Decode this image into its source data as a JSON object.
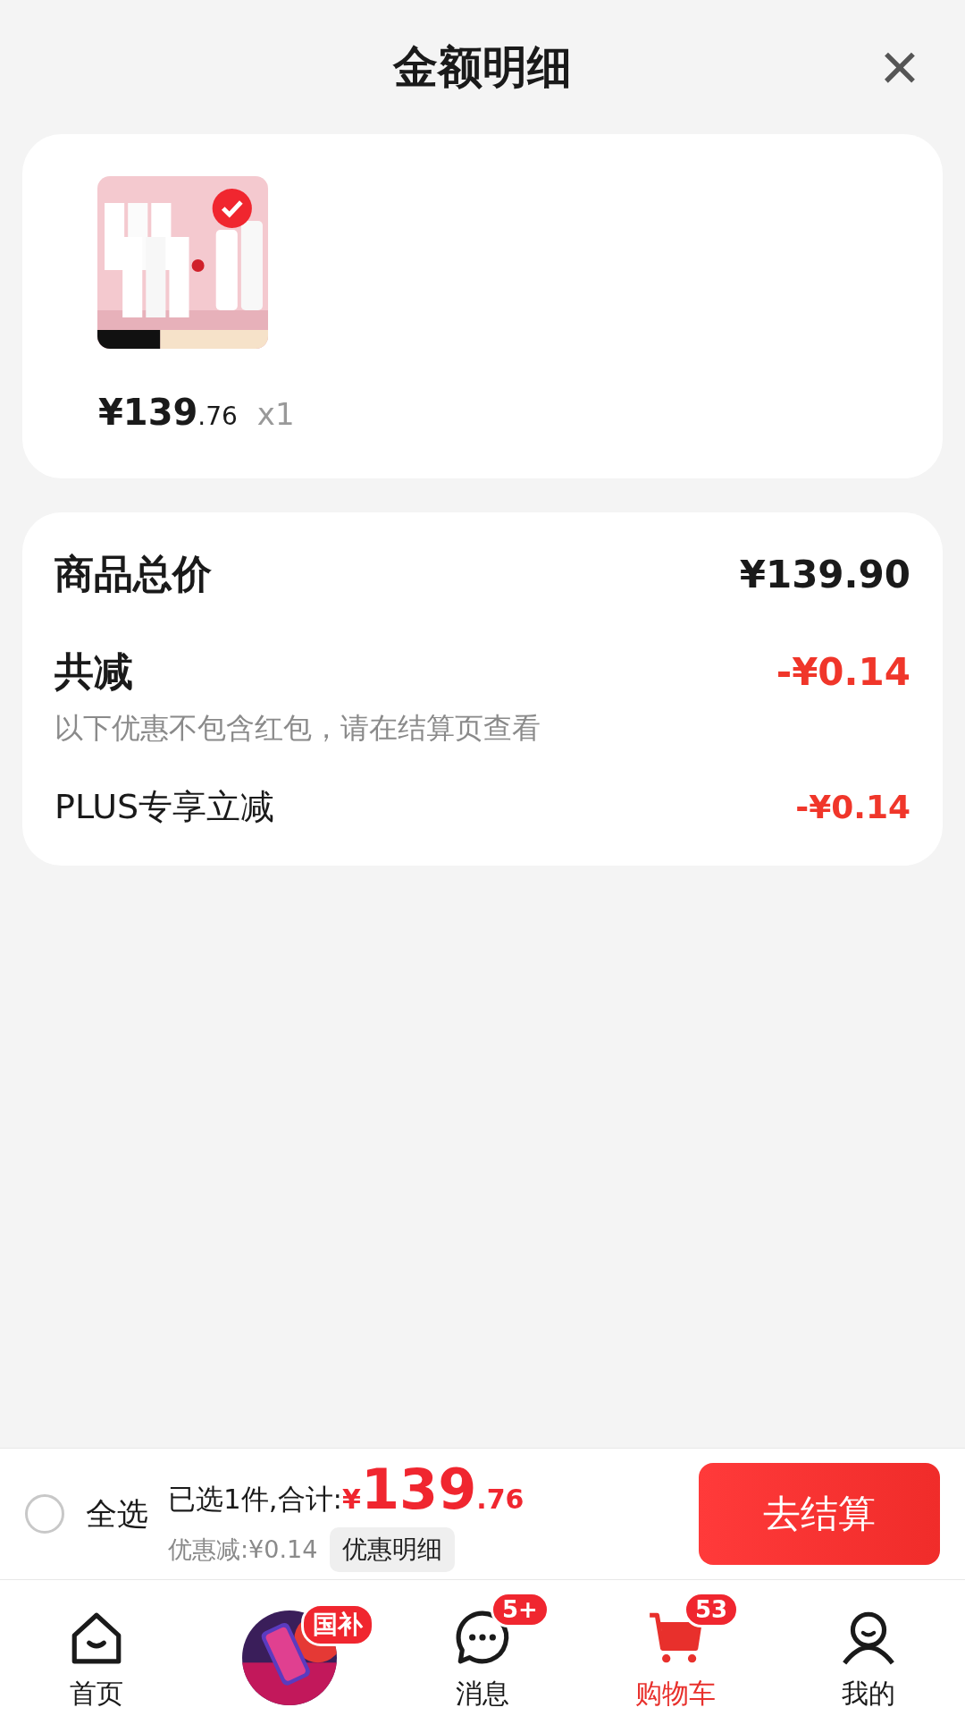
{
  "header": {
    "title": "金额明细",
    "close": "×"
  },
  "product": {
    "price_int": "¥139",
    "price_dec": ".76",
    "quantity": "x1"
  },
  "summary": {
    "total_label": "商品总价",
    "total_value": "¥139.90",
    "discount_label": "共减",
    "discount_value": "-¥0.14",
    "discount_note": "以下优惠不包含红包，请在结算页查看",
    "items": [
      {
        "label": "PLUS专享立减",
        "value": "-¥0.14"
      }
    ]
  },
  "checkout_bar": {
    "select_all": {
      "label": "全选",
      "checked": false
    },
    "selected_text": "已选1件,合计:",
    "currency": "¥",
    "total_int": "139",
    "total_dec": ".76",
    "discount_text": "优惠减:¥0.14",
    "details_button": "优惠明细",
    "checkout_button": "去结算"
  },
  "tabs": [
    {
      "kind": "home",
      "label": "首页",
      "selected": false
    },
    {
      "kind": "promo",
      "badge": "国补",
      "selected": false
    },
    {
      "kind": "message",
      "label": "消息",
      "badge": "5+",
      "selected": false
    },
    {
      "kind": "cart",
      "label": "购物车",
      "badge": "53",
      "selected": true
    },
    {
      "kind": "profile",
      "label": "我的",
      "selected": false
    }
  ]
}
